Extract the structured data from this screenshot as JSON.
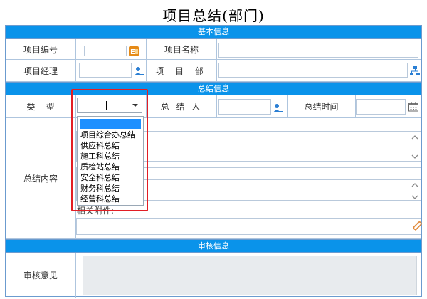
{
  "title": "项目总结(部门)",
  "sections": {
    "basic": "基本信息",
    "summary": "总结信息",
    "review": "审核信息"
  },
  "fields": {
    "project_no": "项目编号",
    "project_name": "项目名称",
    "project_manager": "项目经理",
    "project_dept": "项 目 部",
    "type": "类    型",
    "summarizer": "总 结 人",
    "summary_time": "总结时间",
    "summary_content": "总结内容",
    "attachment": "相关附件:",
    "review_opinion": "审核意见"
  },
  "type_select": {
    "value": "",
    "options": [
      "",
      "项目综合办总结",
      "供应科总结",
      "施工科总结",
      "质检站总结",
      "安全科总结",
      "财务科总结",
      "经营科总结"
    ]
  },
  "colors": {
    "section_bar": "#0a93ea",
    "highlight_box": "#e21e25",
    "selected_option": "#1e90ff"
  },
  "icons": {
    "project_no": "excel-picker-icon",
    "project_manager": "user-picker-icon",
    "project_dept": "org-picker-icon",
    "summarizer": "user-picker-icon",
    "summary_time": "calendar-icon",
    "attachment": "paperclip-icon"
  }
}
